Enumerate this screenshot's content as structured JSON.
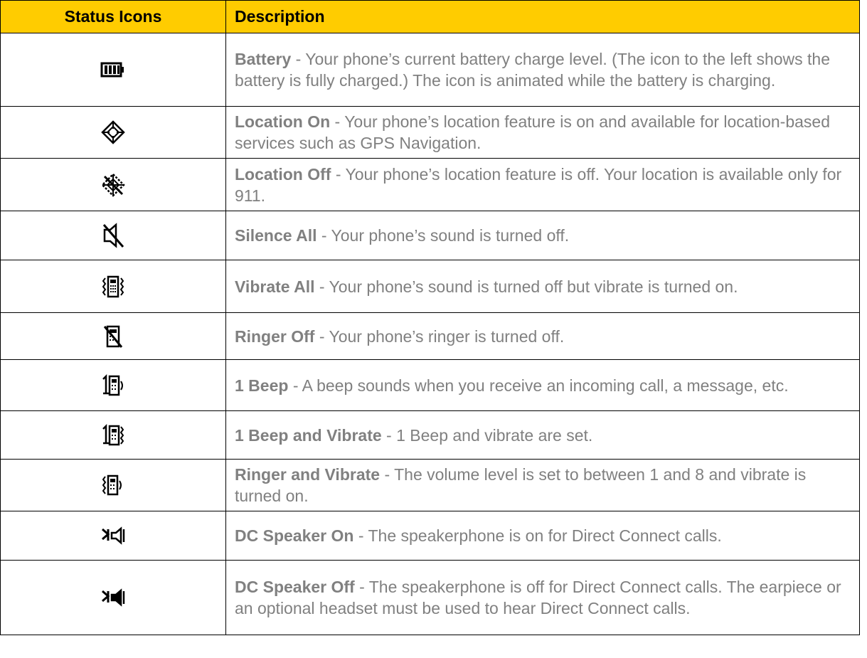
{
  "table": {
    "header": {
      "icon_col": "Status Icons",
      "desc_col": "Description"
    },
    "rows": [
      {
        "icon": "battery-full-icon",
        "term": "Battery",
        "text": " - Your phone’s current battery charge level. (The icon to the left shows the battery is fully charged.) The icon is animated while the battery is charging."
      },
      {
        "icon": "location-on-icon",
        "term": "Location On",
        "text": " - Your phone’s location feature is on and available for location-based services such as GPS Navigation."
      },
      {
        "icon": "location-off-icon",
        "term": "Location Off",
        "text": " - Your phone’s location feature is off. Your location is available only for 911."
      },
      {
        "icon": "silence-all-icon",
        "term": "Silence All",
        "text": " - Your phone’s sound is turned off."
      },
      {
        "icon": "vibrate-all-icon",
        "term": "Vibrate All",
        "text": " - Your phone’s sound is turned off but vibrate is turned on."
      },
      {
        "icon": "ringer-off-icon",
        "term": "Ringer Off",
        "text": " - Your phone’s ringer is turned off."
      },
      {
        "icon": "one-beep-icon",
        "term": "1 Beep",
        "text": " - A beep sounds when you receive an incoming call, a message, etc."
      },
      {
        "icon": "one-beep-vibrate-icon",
        "term": "1 Beep and Vibrate",
        "text": " - 1 Beep and vibrate are set."
      },
      {
        "icon": "ringer-vibrate-icon",
        "term": "Ringer and Vibrate",
        "text": " - The volume level is set to between 1 and 8 and vibrate is turned on."
      },
      {
        "icon": "dc-speaker-on-icon",
        "term": "DC Speaker On",
        "text": " - The speakerphone is on for Direct Connect calls."
      },
      {
        "icon": "dc-speaker-off-icon",
        "term": "DC Speaker Off",
        "text": " - The speakerphone is off for Direct Connect calls. The earpiece or an optional headset must be used to hear Direct Connect calls."
      }
    ]
  },
  "colors": {
    "header_bg": "#FFCC00",
    "text_gray": "#808080",
    "border": "#000000"
  }
}
